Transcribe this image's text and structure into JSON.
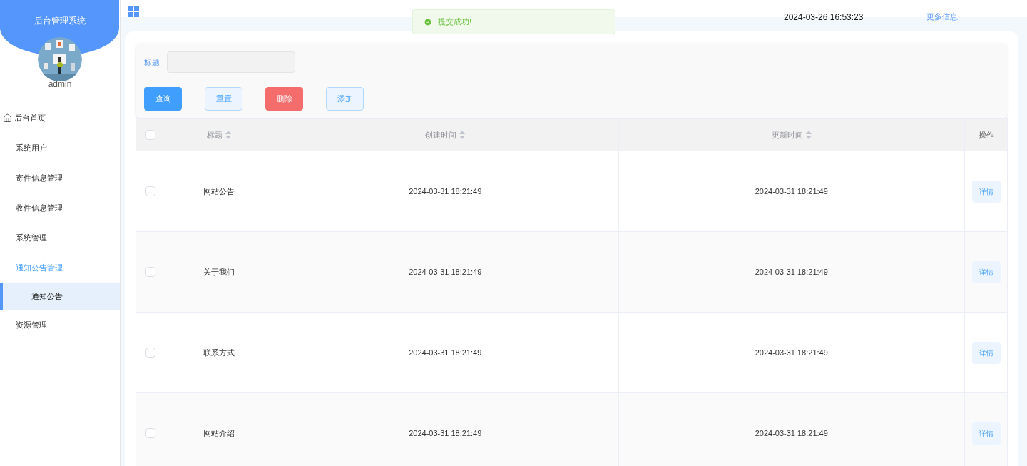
{
  "sidebar": {
    "title": "后台管理系统",
    "user": "admin",
    "items": [
      {
        "label": "后台首页",
        "expanded": false
      },
      {
        "label": "系统用户",
        "expanded": false
      },
      {
        "label": "寄件信息管理",
        "expanded": false
      },
      {
        "label": "收件信息管理",
        "expanded": false
      },
      {
        "label": "系统管理",
        "expanded": false
      },
      {
        "label": "通知公告管理",
        "expanded": true,
        "children": [
          {
            "label": "通知公告",
            "selected": true
          }
        ]
      },
      {
        "label": "资源管理",
        "expanded": false
      }
    ]
  },
  "header": {
    "datetime": "2024-03-26 16:53:23",
    "link": "更多信息"
  },
  "toast": {
    "message": "提交成功!"
  },
  "search": {
    "label": "标题"
  },
  "buttons": [
    {
      "label": "查询",
      "kind": "primary"
    },
    {
      "label": "重置",
      "kind": "plain"
    },
    {
      "label": "删除",
      "kind": "danger"
    },
    {
      "label": "添加",
      "kind": "plain"
    }
  ],
  "table": {
    "columns": [
      {
        "label": "标题",
        "sortable": true
      },
      {
        "label": "创建时间",
        "sortable": true
      },
      {
        "label": "更新时间",
        "sortable": true
      },
      {
        "label": "操作",
        "sortable": false
      }
    ],
    "all_checked": false,
    "rows": [
      {
        "checked": false,
        "title": "网站公告",
        "created": "2024-03-31 18:21:49",
        "updated": "2024-03-31 18:21:49",
        "action": "详情"
      },
      {
        "checked": false,
        "title": "关于我们",
        "created": "2024-03-31 18:21:49",
        "updated": "2024-03-31 18:21:49",
        "action": "详情"
      },
      {
        "checked": false,
        "title": "联系方式",
        "created": "2024-03-31 18:21:49",
        "updated": "2024-03-31 18:21:49",
        "action": "详情"
      },
      {
        "checked": false,
        "title": "网站介绍",
        "created": "2024-03-31 18:21:49",
        "updated": "2024-03-31 18:21:49",
        "action": "详情"
      }
    ]
  }
}
